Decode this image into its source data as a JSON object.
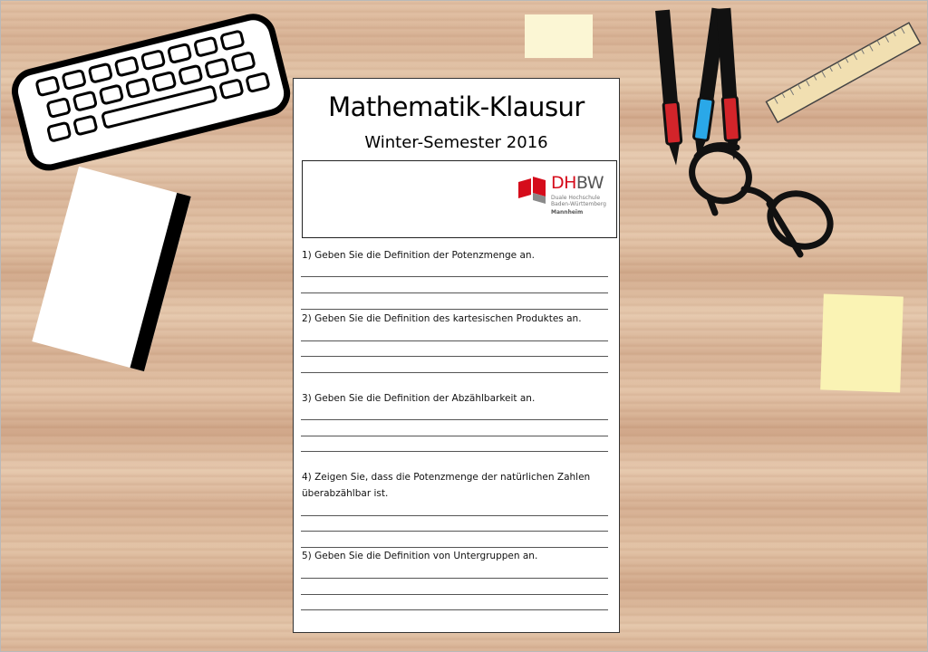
{
  "exam": {
    "title": "Mathematik-Klausur",
    "subtitle": "Winter-Semester 2016",
    "logo": {
      "dh": "DH",
      "bw": "BW",
      "line1": "Duale Hochschule",
      "line2": "Baden-Württemberg",
      "line3": "Mannheim"
    },
    "questions": [
      {
        "text": "1) Geben Sie die Definition der Potenzmenge an."
      },
      {
        "text": "2) Geben Sie die Definition des kartesischen Produktes an."
      },
      {
        "text": "3) Geben Sie die Definition der Abzählbarkeit an."
      },
      {
        "text": "4) Zeigen Sie, dass die Potenzmenge der natürlichen Zahlen überabzählbar ist."
      },
      {
        "text": "5) Geben Sie die Definition von Untergruppen an."
      }
    ]
  },
  "colors": {
    "brand_red": "#d50c1b",
    "pen_red": "#d3242a",
    "pen_blue": "#2aa8e8",
    "sticky_note": "#faf3b4",
    "ruler": "#f1dfb1"
  },
  "icons": [
    "keyboard-icon",
    "notebook-icon",
    "pens-icon",
    "ruler-icon",
    "glasses-icon",
    "sticky-note-icon",
    "dhbw-logo-icon"
  ]
}
